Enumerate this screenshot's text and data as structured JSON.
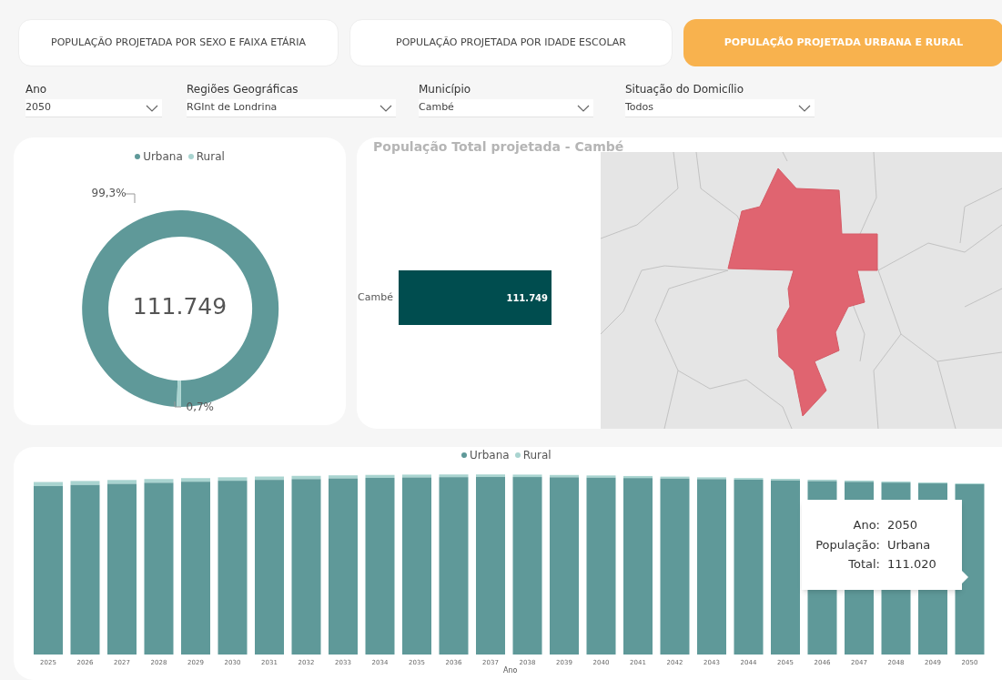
{
  "tabs": [
    {
      "label": "POPULAÇÃO PROJETADA POR SEXO E FAIXA ETÁRIA",
      "selected": false
    },
    {
      "label": "POPULAÇÃO PROJETADA POR IDADE ESCOLAR",
      "selected": false
    },
    {
      "label": "POPULAÇÃO PROJETADA URBANA E RURAL",
      "selected": true
    }
  ],
  "filters": [
    {
      "label": "Ano",
      "value": "2050"
    },
    {
      "label": "Regiões Geográficas",
      "value": "RGInt de Londrina"
    },
    {
      "label": "Município",
      "value": "Cambé"
    },
    {
      "label": "Situação do Domicílio",
      "value": "Todos"
    }
  ],
  "donut_card": {
    "legend": [
      {
        "color": "#5f9999"
      },
      {
        "color": "#a9d4d0"
      }
    ],
    "total": "111.749",
    "chart_data": {
      "type": "donut",
      "categories": [
        "Urbana",
        "Rural"
      ],
      "values": [
        99.3,
        0.7
      ],
      "value_labels": [
        "99,3%",
        "0,7%"
      ]
    }
  },
  "bar_card": {
    "title": "População Total projetada - Cambé",
    "rows": [
      {
        "label": "Cambé",
        "value": "111.749"
      }
    ]
  },
  "map": {
    "kind": "map"
  },
  "yearly_card": {
    "legend": [
      {
        "label": "Urbana",
        "color": "#5f9999"
      },
      {
        "label": "Rural",
        "color": "#a9d4d0"
      }
    ],
    "years": [
      "2025",
      "2026",
      "2027",
      "2028",
      "2029",
      "2030",
      "2031",
      "2032",
      "2033",
      "2034",
      "2035",
      "2036",
      "2037",
      "2038",
      "2039",
      "2040",
      "2041",
      "2042",
      "2043",
      "2044",
      "2045",
      "2046",
      "2047",
      "2048",
      "2049",
      "2050"
    ],
    "axis_label": "Ano",
    "tooltip": [
      {
        "label": "Ano:",
        "value": "2050"
      },
      {
        "label": "População:",
        "value": "Urbana"
      },
      {
        "label": "Total:",
        "value": "111.020"
      }
    ]
  }
}
